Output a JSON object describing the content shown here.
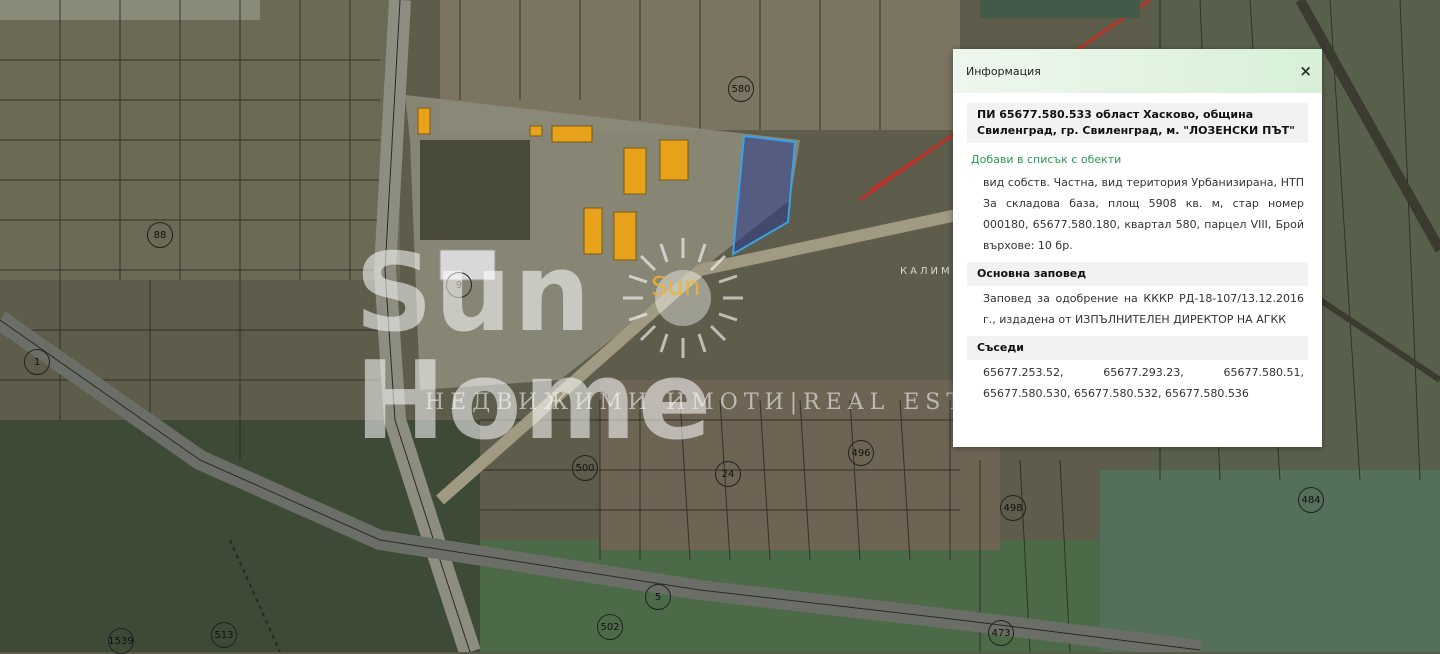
{
  "map": {
    "plot_labels": [
      "580",
      "88",
      "9",
      "500",
      "24",
      "496",
      "498",
      "484",
      "473",
      "502",
      "5",
      "513",
      "1539",
      "1"
    ],
    "street_label": "КАЛИМ",
    "watermark": {
      "brand": "Sun Home",
      "logo_word": "Sun",
      "tagline": "НЕДВИЖИМИ ИМОТИ|REAL ESTATE"
    },
    "colors": {
      "highlight_parcel": "#3aa0e8",
      "buildings": "#e8a21c",
      "road_red": "#b8332a"
    }
  },
  "panel": {
    "title": "Информация",
    "close_glyph": "×",
    "property_heading": "ПИ 65677.580.533 област Хасково, община Свиленград, гр. Свиленград, м. \"ЛОЗЕНСКИ ПЪТ\"",
    "add_link": "Добави в списък с обекти",
    "details": "вид собств. Частна, вид територия Урбанизирана, НТП За складова база, площ 5908 кв. м, стар номер 000180, 65677.580.180, квартал 580, парцел VIII, Брой върхове: 10 бр.",
    "order_heading": "Основна заповед",
    "order_text": "Заповед за одобрение на КККР РД-18-107/13.12.2016 г., издадена от ИЗПЪЛНИТЕЛЕН ДИРЕКТОР НА АГКК",
    "neighbors_heading": "Съседи",
    "neighbors_text": "65677.253.52, 65677.293.23, 65677.580.51, 65677.580.530, 65677.580.532, 65677.580.536"
  }
}
